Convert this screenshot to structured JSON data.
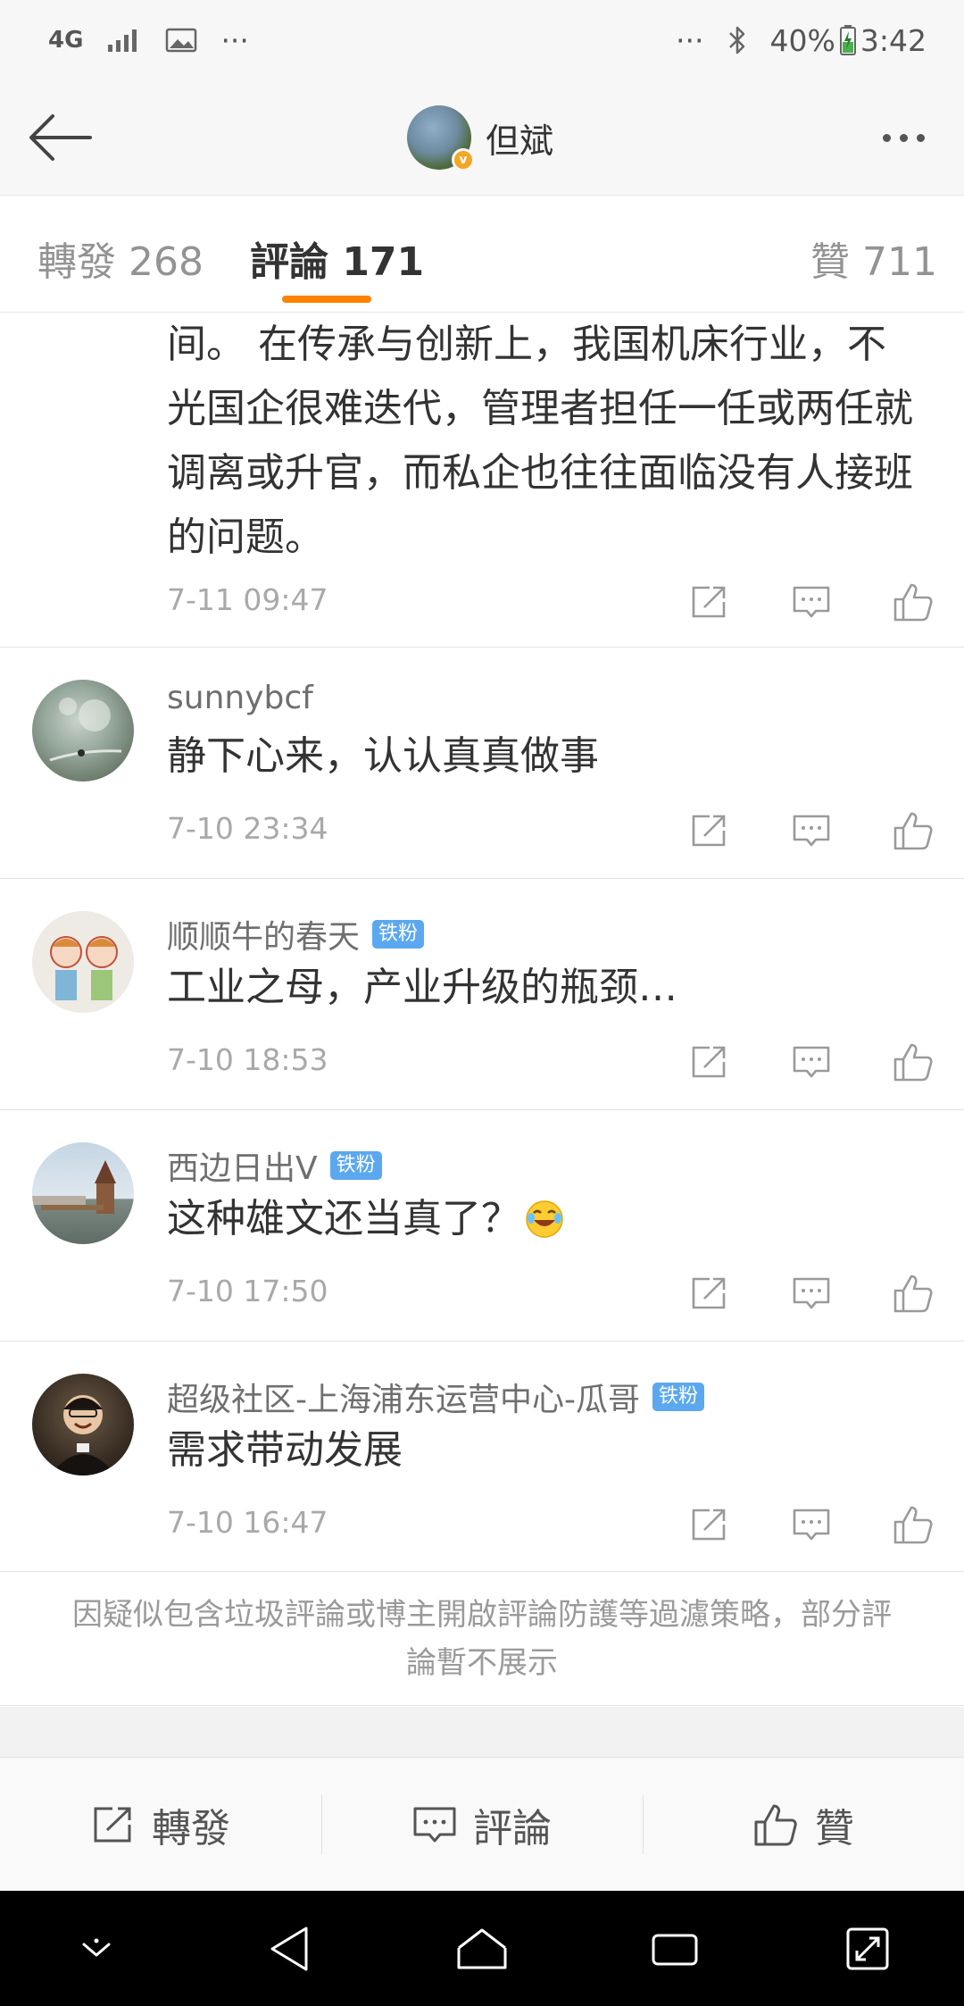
{
  "status_bar": {
    "network": "4G",
    "left_more": "···",
    "right_more": "···",
    "battery": "40%",
    "time": "3:42"
  },
  "header": {
    "title": "但斌",
    "verified_badge": "v"
  },
  "tabs": {
    "reposts": "轉發 268",
    "comments": "評論 171",
    "likes": "贊 711"
  },
  "comments": [
    {
      "name": "",
      "badge": "",
      "text_lines": [
        "间。 在传承与创新上，我国机床行业，不",
        "光国企很难迭代，管理者担任一任或两任就",
        "调离或升官，而私企也往往面临没有人接班",
        "的问题。"
      ],
      "time": "7-11 09:47"
    },
    {
      "name": "sunnybcf",
      "badge": "",
      "text": "静下心来，认认真真做事",
      "time": "7-10 23:34"
    },
    {
      "name": "顺顺牛的春天",
      "badge": "铁粉",
      "text": "工业之母，产业升级的瓶颈…",
      "time": "7-10 18:53"
    },
    {
      "name": "西边日出V",
      "badge": "铁粉",
      "text": "这种雄文还当真了？",
      "time": "7-10 17:50"
    },
    {
      "name": "超级社区-上海浦东运营中心-瓜哥",
      "badge": "铁粉",
      "text": "需求带动发展",
      "time": "7-10 16:47"
    }
  ],
  "notice": "因疑似包含垃圾評論或博主開啟評論防護等過濾策略，部分評論暫不展示",
  "bottom_bar": {
    "repost": "轉發",
    "comment": "評論",
    "like": "贊"
  },
  "colors": {
    "accent": "#ff8200",
    "fan_badge": "#5ba8f0",
    "verified": "#f5a623"
  },
  "icons": [
    "back-arrow-icon",
    "more-icon",
    "share-icon",
    "comment-icon",
    "like-icon",
    "laughing-emoji-icon"
  ]
}
